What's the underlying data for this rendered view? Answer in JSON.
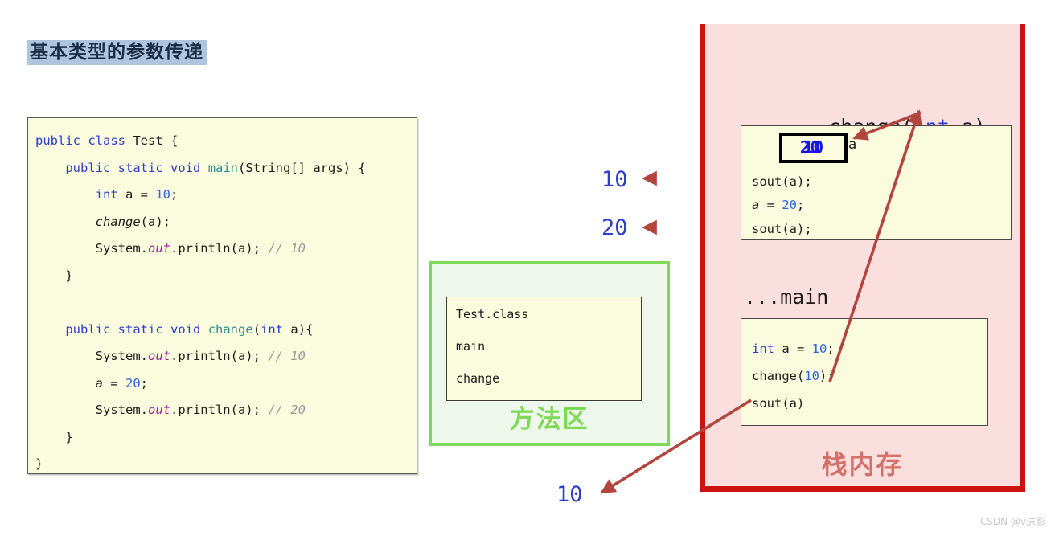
{
  "title": "基本类型的参数传递",
  "colors": {
    "title_highlight": "#adc6dd",
    "code_bg": "#fbfbdd",
    "method_area_green": "#7ed957",
    "stack_red": "#cc1111",
    "stack_pink": "#fbdfdf",
    "stack_label": "#d4706a",
    "arrow_red": "#b3453f",
    "value_blue": "#1414e0",
    "keyword_blue": "#2b3ec9"
  },
  "code_panel": {
    "lines": [
      {
        "id": "l1",
        "tokens": [
          {
            "t": "public",
            "c": "kw"
          },
          {
            "t": " ",
            "c": ""
          },
          {
            "t": "class",
            "c": "kw"
          },
          {
            "t": " Test {",
            "c": ""
          }
        ]
      },
      {
        "id": "l2",
        "tokens": [
          {
            "t": "    ",
            "c": ""
          },
          {
            "t": "public",
            "c": "kw"
          },
          {
            "t": " ",
            "c": ""
          },
          {
            "t": "static",
            "c": "kw"
          },
          {
            "t": " ",
            "c": ""
          },
          {
            "t": "void",
            "c": "kw"
          },
          {
            "t": " ",
            "c": ""
          },
          {
            "t": "main",
            "c": "mth"
          },
          {
            "t": "(String[] args) {",
            "c": ""
          }
        ]
      },
      {
        "id": "l3",
        "tokens": [
          {
            "t": "        ",
            "c": ""
          },
          {
            "t": "int",
            "c": "kw"
          },
          {
            "t": " a = ",
            "c": ""
          },
          {
            "t": "10",
            "c": "num"
          },
          {
            "t": ";",
            "c": ""
          }
        ]
      },
      {
        "id": "l4",
        "tokens": [
          {
            "t": "        ",
            "c": ""
          },
          {
            "t": "change",
            "c": "ital"
          },
          {
            "t": "(a);",
            "c": ""
          }
        ]
      },
      {
        "id": "l5",
        "tokens": [
          {
            "t": "        System.",
            "c": ""
          },
          {
            "t": "out",
            "c": "out"
          },
          {
            "t": ".println(a); ",
            "c": ""
          },
          {
            "t": "// 10",
            "c": "cmt"
          }
        ]
      },
      {
        "id": "l6",
        "tokens": [
          {
            "t": "    }",
            "c": ""
          }
        ]
      },
      {
        "id": "l7",
        "tokens": [
          {
            "t": "",
            "c": ""
          }
        ]
      },
      {
        "id": "l8",
        "tokens": [
          {
            "t": "    ",
            "c": ""
          },
          {
            "t": "public",
            "c": "kw"
          },
          {
            "t": " ",
            "c": ""
          },
          {
            "t": "static",
            "c": "kw"
          },
          {
            "t": " ",
            "c": ""
          },
          {
            "t": "void",
            "c": "kw"
          },
          {
            "t": " ",
            "c": ""
          },
          {
            "t": "change",
            "c": "mth"
          },
          {
            "t": "(",
            "c": ""
          },
          {
            "t": "int",
            "c": "kw"
          },
          {
            "t": " a){",
            "c": ""
          }
        ]
      },
      {
        "id": "l9",
        "tokens": [
          {
            "t": "        System.",
            "c": ""
          },
          {
            "t": "out",
            "c": "out"
          },
          {
            "t": ".println(a); ",
            "c": ""
          },
          {
            "t": "// 10",
            "c": "cmt"
          }
        ]
      },
      {
        "id": "l10",
        "tokens": [
          {
            "t": "        ",
            "c": ""
          },
          {
            "t": "a",
            "c": "ital"
          },
          {
            "t": " = ",
            "c": ""
          },
          {
            "t": "20",
            "c": "num"
          },
          {
            "t": ";",
            "c": ""
          }
        ]
      },
      {
        "id": "l11",
        "tokens": [
          {
            "t": "        System.",
            "c": ""
          },
          {
            "t": "out",
            "c": "out"
          },
          {
            "t": ".println(a); ",
            "c": ""
          },
          {
            "t": "// 20",
            "c": "cmt"
          }
        ]
      },
      {
        "id": "l12",
        "tokens": [
          {
            "t": "    }",
            "c": ""
          }
        ]
      },
      {
        "id": "l13",
        "tokens": [
          {
            "t": "}",
            "c": ""
          }
        ]
      }
    ]
  },
  "method_area": {
    "label": "方法区",
    "entries": [
      "Test.class",
      "main",
      "change"
    ]
  },
  "stack": {
    "label": "栈内存",
    "change_frame": {
      "title_prefix": "...change(",
      "title_type": "int",
      "title_suffix": " a)",
      "var_label": "a",
      "value_old": "10",
      "value_new": "20",
      "lines": [
        {
          "id": "c1",
          "tokens": [
            {
              "t": "sout(a);",
              "c": ""
            }
          ]
        },
        {
          "id": "c2",
          "tokens": [
            {
              "t": "a",
              "c": "ital"
            },
            {
              "t": " = ",
              "c": ""
            },
            {
              "t": "20",
              "c": "num"
            },
            {
              "t": ";",
              "c": ""
            }
          ]
        },
        {
          "id": "c3",
          "tokens": [
            {
              "t": "sout(a);",
              "c": ""
            }
          ]
        }
      ]
    },
    "main_frame": {
      "title": "...main",
      "lines": [
        {
          "id": "m1",
          "tokens": [
            {
              "t": "int",
              "c": "kw"
            },
            {
              "t": " a = ",
              "c": ""
            },
            {
              "t": "10",
              "c": "num"
            },
            {
              "t": ";",
              "c": ""
            }
          ]
        },
        {
          "id": "m2",
          "tokens": [
            {
              "t": "change(",
              "c": ""
            },
            {
              "t": "10",
              "c": "num"
            },
            {
              "t": ");",
              "c": ""
            }
          ]
        },
        {
          "id": "m3",
          "tokens": [
            {
              "t": "sout(a)",
              "c": ""
            }
          ]
        }
      ]
    }
  },
  "callouts": {
    "change_sout_first": "10",
    "change_sout_second": "20",
    "main_sout": "10"
  },
  "watermark": "CSDN @v沫影"
}
